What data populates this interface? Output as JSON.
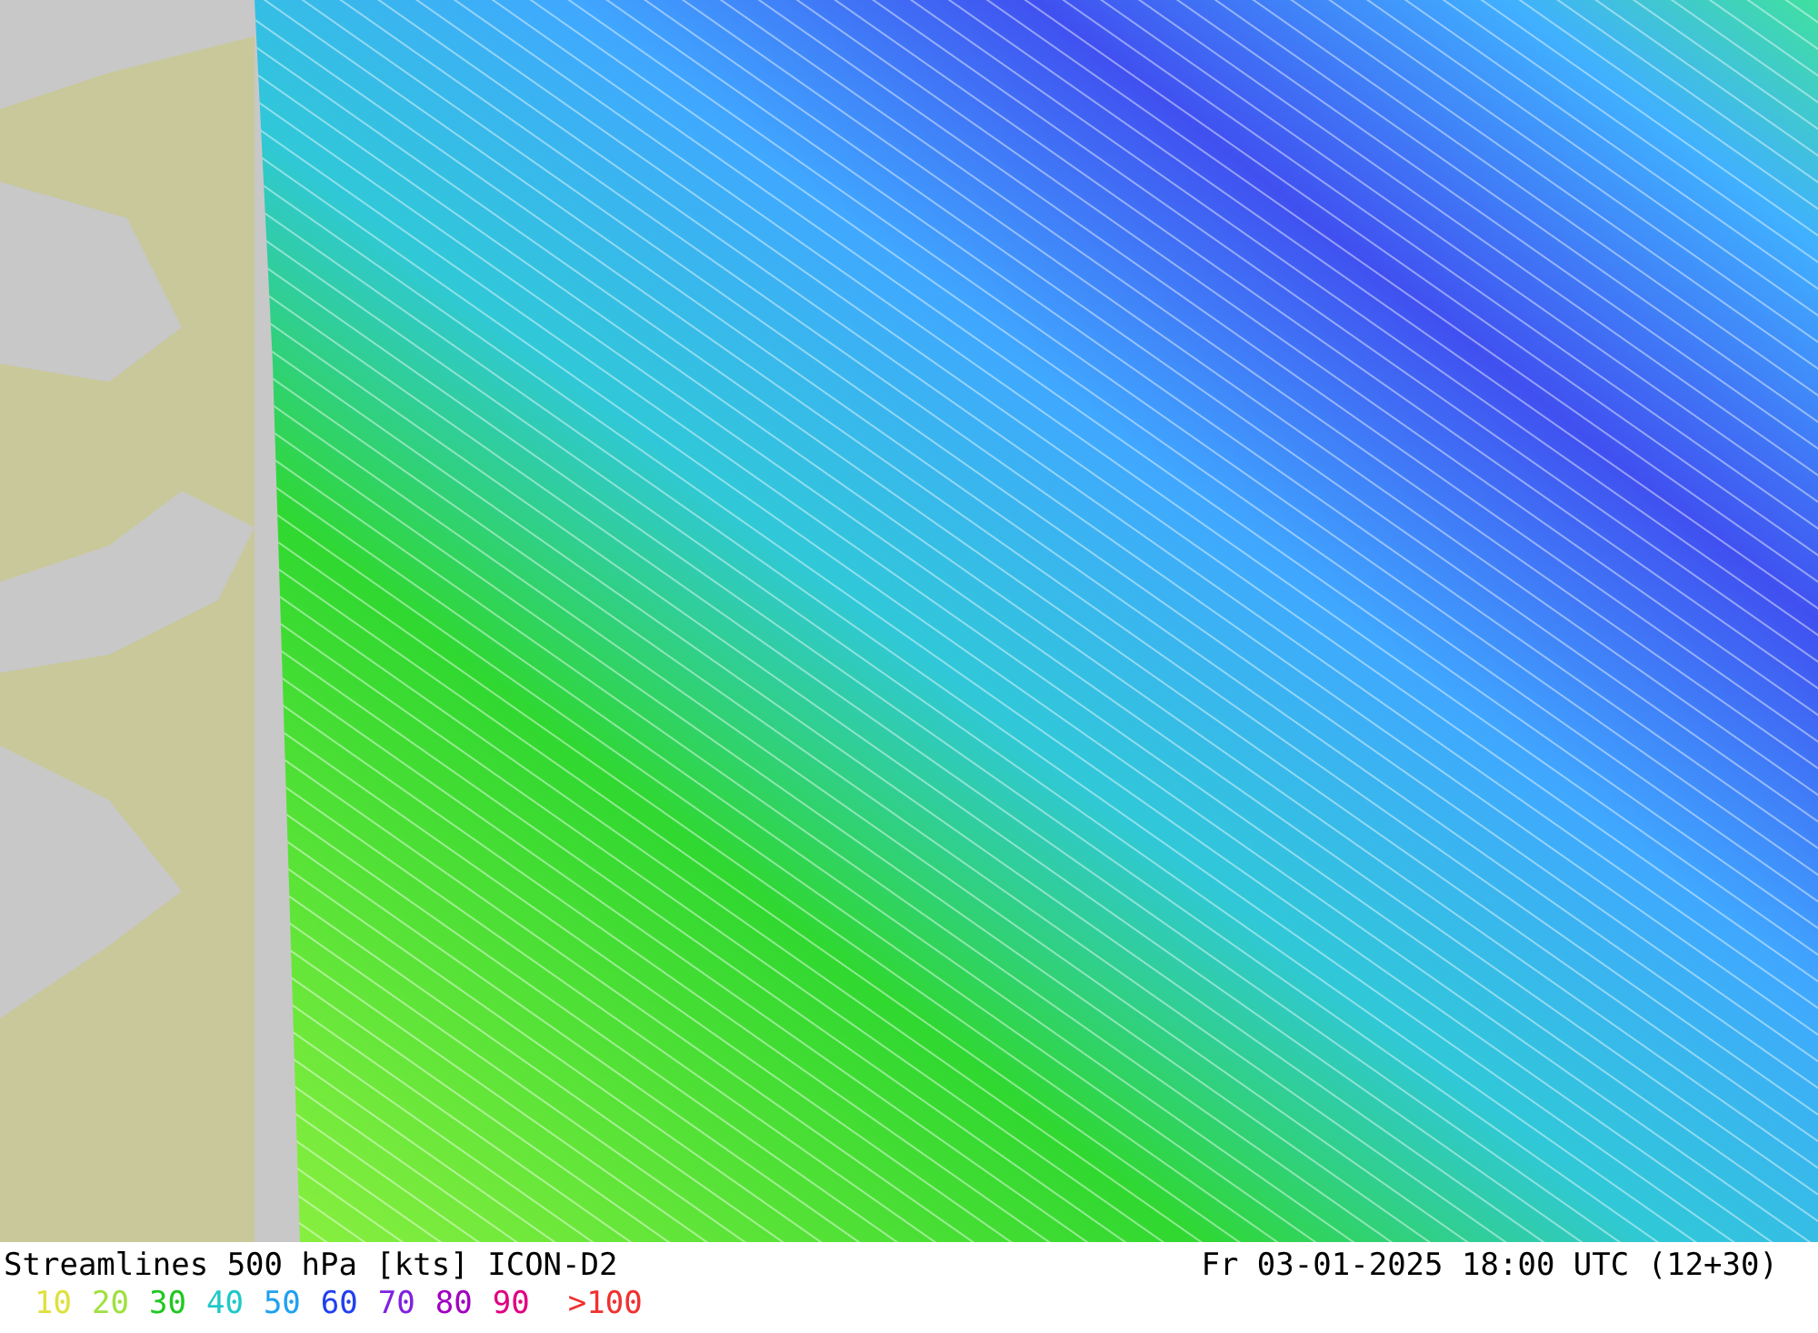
{
  "caption": {
    "title": "Streamlines 500 hPa [kts] ICON-D2",
    "valid_time": "Fr 03-01-2025 18:00 UTC (12+30)"
  },
  "legend": [
    {
      "label": "10",
      "color": "#e0e040"
    },
    {
      "label": "20",
      "color": "#a0e040"
    },
    {
      "label": "30",
      "color": "#20c820"
    },
    {
      "label": "40",
      "color": "#20c8c8"
    },
    {
      "label": "50",
      "color": "#20a0f0"
    },
    {
      "label": "60",
      "color": "#2040f0"
    },
    {
      "label": "70",
      "color": "#8020e0"
    },
    {
      "label": "80",
      "color": "#a000c0"
    },
    {
      "label": "90",
      "color": "#e00080"
    },
    {
      "label": ">100",
      "color": "#f03030"
    }
  ]
}
